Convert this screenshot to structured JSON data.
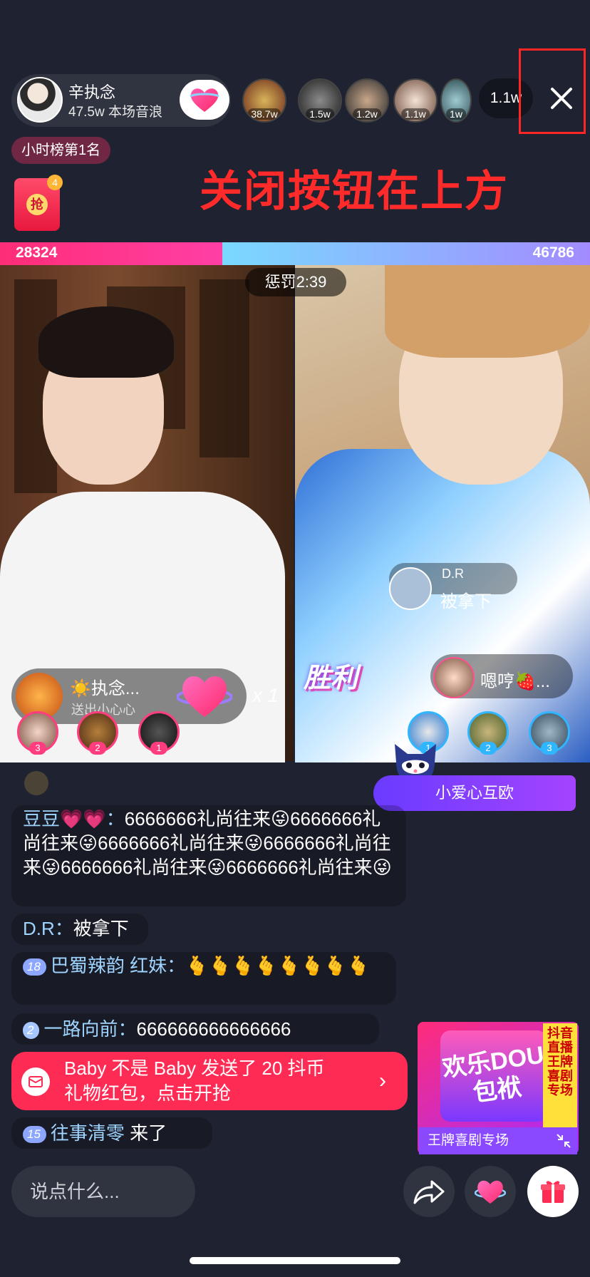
{
  "host": {
    "name": "辛执念",
    "stat": "47.5w 本场音浪"
  },
  "viewers": [
    {
      "badge": "38.7w"
    },
    {
      "badge": "1.5w"
    },
    {
      "badge": "1.2w"
    },
    {
      "badge": "1.1w"
    },
    {
      "badge": "1w"
    }
  ],
  "viewer_count": "1.1w",
  "rank_label": "小时榜第1名",
  "red_envelope": {
    "label": "抢",
    "count": "4"
  },
  "annotation": "关闭按钮在上方",
  "pk": {
    "left_score": "28324",
    "right_score": "46786",
    "left_progress": 0.377,
    "timer": "惩罚2:39"
  },
  "right_anchor": {
    "name": "D.R",
    "message": "被拿下"
  },
  "result_label": "胜利",
  "left_gift": {
    "name": "☀️执念...",
    "desc": "送出小心心",
    "multiplier": "x 1"
  },
  "right_gift": {
    "name": "嗯哼🍓..."
  },
  "left_ranks": [
    "3",
    "2",
    "1"
  ],
  "right_ranks": [
    "1",
    "2",
    "3"
  ],
  "love_banner": "小爱心互欧",
  "chat": [
    {
      "id": "c1",
      "name": "豆豆💗💗：",
      "text": "6666666礼尚往来😜6666666礼尚往来😜6666666礼尚往来😜6666666礼尚往来😜6666666礼尚往来😜6666666礼尚往来😜"
    },
    {
      "id": "c2",
      "name": "D.R：",
      "text": "被拿下"
    },
    {
      "id": "c3",
      "level": "18",
      "name": "巴蜀辣韵 红妹：",
      "text": "🫰🫰🫰🫰🫰🫰🫰🫰"
    },
    {
      "id": "c4",
      "level": "2",
      "name": "一路向前：",
      "text": "666666666666666"
    },
    {
      "id": "c5",
      "level": "15",
      "name": "往事清零",
      "text": " 来了"
    }
  ],
  "system_notice": {
    "line1": "Baby 不是 Baby 发送了 20 抖币",
    "line2": "礼物红包，点击开抢"
  },
  "promo": {
    "title": "欢乐DOU包袱",
    "side": "抖音直播王牌喜剧专场",
    "footer": "王牌喜剧专场"
  },
  "input_placeholder": "说点什么...",
  "colors": {
    "accent": "#fe2c55",
    "pk_left": "#ff2d78",
    "pk_right": "#79d9ff",
    "highlight_box": "#ff2626"
  },
  "icons": [
    "heart-icon",
    "close-icon",
    "share-icon",
    "gift-icon",
    "envelope-icon",
    "chevron-right-icon",
    "minimize-icon"
  ]
}
